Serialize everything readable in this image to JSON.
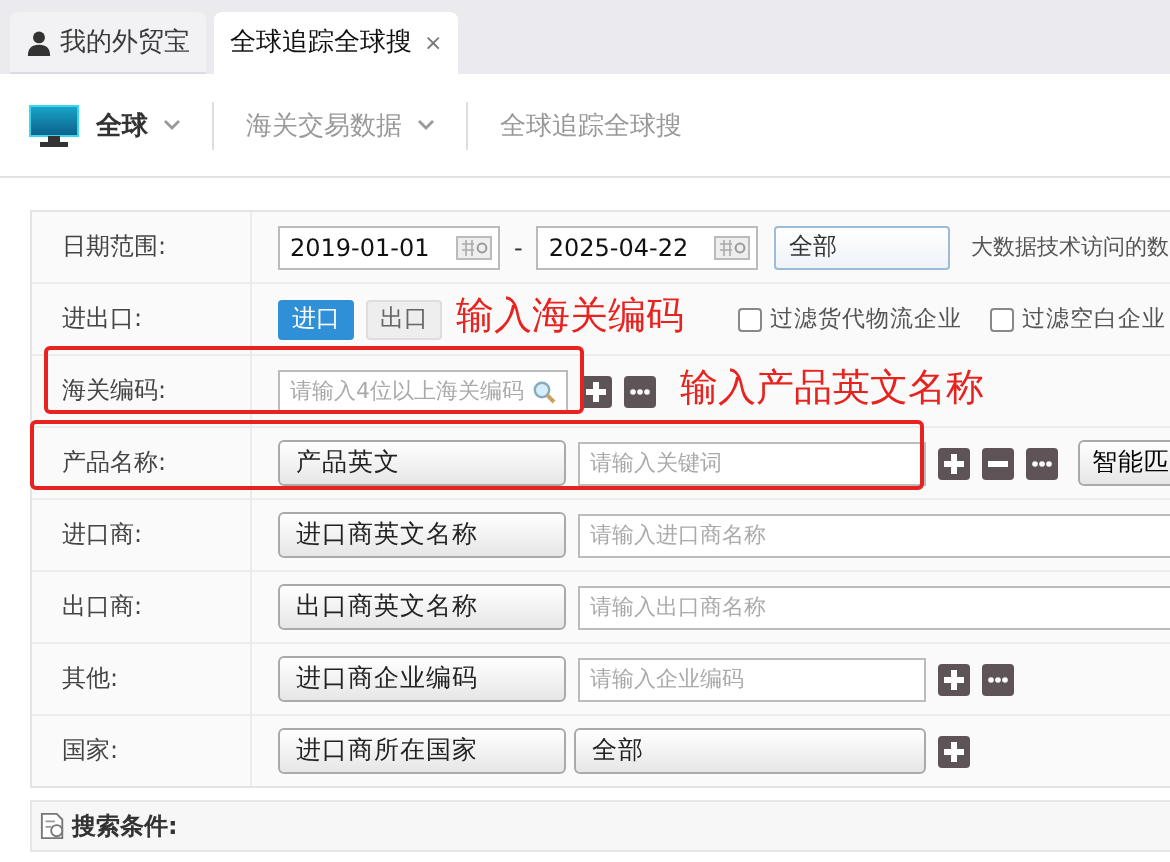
{
  "tabs": [
    {
      "label": "我的外贸宝",
      "kind": "home",
      "selected": false
    },
    {
      "label": "全球追踪全球搜",
      "kind": "closable",
      "close": "×",
      "selected": true
    }
  ],
  "nav": [
    {
      "label": "全球",
      "kind": "brand",
      "selected": true,
      "dropdown": true
    },
    {
      "label": "海关交易数据",
      "kind": "link",
      "selected": false,
      "dropdown": true
    },
    {
      "label": "全球追踪全球搜",
      "kind": "link",
      "selected": false,
      "dropdown": false
    }
  ],
  "form": [
    {
      "kind": "date_range",
      "label": "日期范围:",
      "from": "2019-01-01",
      "separator": "-",
      "to": "2025-04-22",
      "select": "全部",
      "note": "大数据技术访问的数"
    },
    {
      "kind": "toggle",
      "label": "进出口:",
      "options": [
        {
          "label": "进口",
          "selected": true
        },
        {
          "label": "出口",
          "selected": false
        }
      ],
      "filters": [
        {
          "label": "过滤货代物流企业",
          "checked": false
        },
        {
          "label": "过滤空白企业",
          "checked": false
        }
      ]
    },
    {
      "kind": "code",
      "label": "海关编码:",
      "placeholder": "请输入4位以上海关编码",
      "buttons": [
        {
          "kind": "add"
        },
        {
          "kind": "more"
        }
      ],
      "highlighted": true
    },
    {
      "kind": "selector",
      "label": "产品名称:",
      "selector": "产品英文",
      "placeholder": "请输入关键词",
      "wide": false,
      "buttons": [
        {
          "kind": "add"
        },
        {
          "kind": "remove"
        },
        {
          "kind": "more"
        }
      ],
      "extra": "智能匹",
      "highlighted": true
    },
    {
      "kind": "selector",
      "label": "进口商:",
      "selector": "进口商英文名称",
      "placeholder": "请输入进口商名称",
      "wide": true
    },
    {
      "kind": "selector",
      "label": "出口商:",
      "selector": "出口商英文名称",
      "placeholder": "请输入出口商名称",
      "wide": true
    },
    {
      "kind": "selector",
      "label": "其他:",
      "selector": "进口商企业编码",
      "placeholder": "请输入企业编码",
      "wide": false,
      "buttons": [
        {
          "kind": "add"
        },
        {
          "kind": "more"
        }
      ]
    },
    {
      "kind": "country",
      "label": "国家:",
      "selector": "进口商所在国家",
      "select": "全部",
      "buttons": [
        {
          "kind": "add"
        }
      ]
    }
  ],
  "annotations": [
    {
      "text": "输入海关编码"
    },
    {
      "text": "输入产品英文名称"
    }
  ],
  "footer": {
    "title": "搜索条件:"
  }
}
